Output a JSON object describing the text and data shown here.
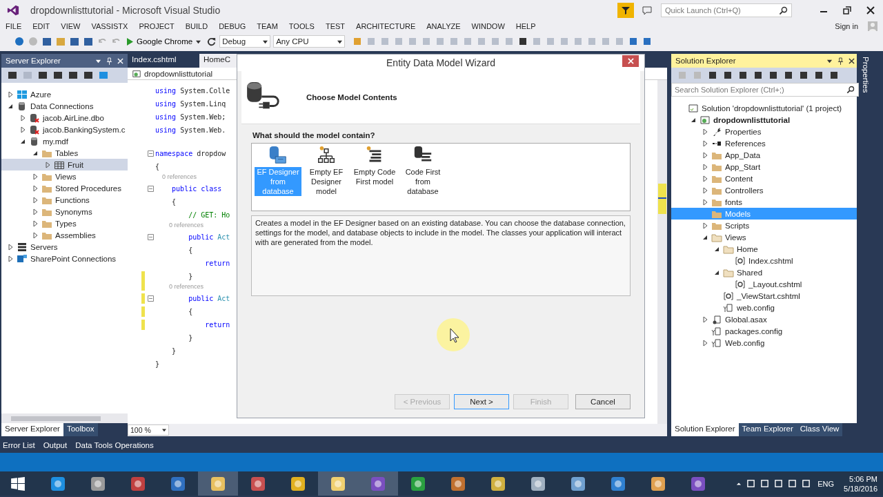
{
  "window": {
    "title": "dropdownlisttutorial - Microsoft Visual Studio",
    "quick_launch": {
      "placeholder": "Quick Launch (Ctrl+Q)"
    }
  },
  "menu": [
    "FILE",
    "EDIT",
    "VIEW",
    "VASSISTX",
    "PROJECT",
    "BUILD",
    "DEBUG",
    "TEAM",
    "TOOLS",
    "TEST",
    "ARCHITECTURE",
    "ANALYZE",
    "WINDOW",
    "HELP"
  ],
  "sign_in": "Sign in",
  "toolbar": {
    "run_target": "Google Chrome",
    "configuration": "Debug",
    "platform": "Any CPU"
  },
  "server_explorer": {
    "title": "Server Explorer",
    "tree": [
      {
        "label": "Azure",
        "kind": "azure",
        "expanded": false,
        "selected": false
      },
      {
        "label": "Data Connections",
        "kind": "connections",
        "expanded": true,
        "selected": false,
        "children": [
          {
            "label": "jacob.AirLine.dbo",
            "kind": "db-error",
            "expanded": false,
            "selected": false
          },
          {
            "label": "jacob.BankingSystem.c",
            "kind": "db-error",
            "expanded": false,
            "selected": false
          },
          {
            "label": "my.mdf",
            "kind": "db",
            "expanded": true,
            "selected": false,
            "children": [
              {
                "label": "Tables",
                "kind": "folder",
                "expanded": true,
                "selected": false,
                "children": [
                  {
                    "label": "Fruit",
                    "kind": "table",
                    "expanded": false,
                    "selected": true
                  }
                ]
              },
              {
                "label": "Views",
                "kind": "folder",
                "expanded": false,
                "selected": false
              },
              {
                "label": "Stored Procedures",
                "kind": "folder",
                "expanded": false,
                "selected": false
              },
              {
                "label": "Functions",
                "kind": "folder",
                "expanded": false,
                "selected": false
              },
              {
                "label": "Synonyms",
                "kind": "folder",
                "expanded": false,
                "selected": false
              },
              {
                "label": "Types",
                "kind": "folder",
                "expanded": false,
                "selected": false
              },
              {
                "label": "Assemblies",
                "kind": "folder",
                "expanded": false,
                "selected": false
              }
            ]
          }
        ]
      },
      {
        "label": "Servers",
        "kind": "servers",
        "expanded": false,
        "selected": false
      },
      {
        "label": "SharePoint Connections",
        "kind": "sharepoint",
        "expanded": false,
        "selected": false
      }
    ]
  },
  "editor": {
    "tabs": [
      {
        "label": "Index.cshtml",
        "selected": false
      },
      {
        "label": "HomeC",
        "selected": true
      }
    ],
    "navigation": "dropdownlisttutorial",
    "zoom": "100 %",
    "lines": [
      {
        "kind": "code",
        "fold": false,
        "changed": false,
        "segments": [
          {
            "kind": "keyword",
            "text": "using"
          },
          {
            "kind": "plain",
            "text": " System.Colle"
          }
        ]
      },
      {
        "kind": "code",
        "fold": false,
        "changed": false,
        "segments": [
          {
            "kind": "keyword",
            "text": "using"
          },
          {
            "kind": "plain",
            "text": " System.Linq"
          }
        ]
      },
      {
        "kind": "code",
        "fold": false,
        "changed": false,
        "segments": [
          {
            "kind": "keyword",
            "text": "using"
          },
          {
            "kind": "plain",
            "text": " System.Web;"
          }
        ]
      },
      {
        "kind": "code",
        "fold": false,
        "changed": false,
        "segments": [
          {
            "kind": "keyword",
            "text": "using"
          },
          {
            "kind": "plain",
            "text": " System.Web."
          }
        ]
      },
      {
        "kind": "blank",
        "fold": false,
        "changed": false
      },
      {
        "kind": "code",
        "fold": true,
        "changed": false,
        "segments": [
          {
            "kind": "keyword",
            "text": "namespace"
          },
          {
            "kind": "plain",
            "text": " dropdow"
          }
        ]
      },
      {
        "kind": "code",
        "fold": false,
        "changed": false,
        "segments": [
          {
            "kind": "plain",
            "text": "{"
          }
        ]
      },
      {
        "kind": "lens",
        "fold": false,
        "changed": false,
        "segments": [
          {
            "kind": "plain",
            "text": "    0 references"
          }
        ]
      },
      {
        "kind": "code",
        "fold": true,
        "changed": false,
        "segments": [
          {
            "kind": "keyword",
            "text": "    public class"
          }
        ]
      },
      {
        "kind": "code",
        "fold": false,
        "changed": false,
        "segments": [
          {
            "kind": "plain",
            "text": "    {"
          }
        ]
      },
      {
        "kind": "code",
        "fold": false,
        "changed": false,
        "segments": [
          {
            "kind": "comment",
            "text": "        // GET: Ho"
          }
        ]
      },
      {
        "kind": "lens",
        "fold": false,
        "changed": false,
        "segments": [
          {
            "kind": "plain",
            "text": "        0 references"
          }
        ]
      },
      {
        "kind": "code",
        "fold": true,
        "changed": false,
        "segments": [
          {
            "kind": "keyword",
            "text": "        public"
          },
          {
            "kind": "type",
            "text": " Act"
          }
        ]
      },
      {
        "kind": "code",
        "fold": false,
        "changed": false,
        "segments": [
          {
            "kind": "plain",
            "text": "        {"
          }
        ]
      },
      {
        "kind": "code",
        "fold": false,
        "changed": false,
        "segments": [
          {
            "kind": "keyword",
            "text": "            return"
          }
        ]
      },
      {
        "kind": "code",
        "fold": false,
        "changed": true,
        "segments": [
          {
            "kind": "plain",
            "text": "        }"
          }
        ]
      },
      {
        "kind": "lens",
        "fold": false,
        "changed": true,
        "segments": [
          {
            "kind": "plain",
            "text": "        0 references"
          }
        ]
      },
      {
        "kind": "code",
        "fold": true,
        "changed": true,
        "segments": [
          {
            "kind": "keyword",
            "text": "        public"
          },
          {
            "kind": "type",
            "text": " Act"
          }
        ]
      },
      {
        "kind": "code",
        "fold": false,
        "changed": true,
        "segments": [
          {
            "kind": "plain",
            "text": "        {"
          }
        ]
      },
      {
        "kind": "code",
        "fold": false,
        "changed": true,
        "segments": [
          {
            "kind": "keyword",
            "text": "            return"
          }
        ]
      },
      {
        "kind": "code",
        "fold": false,
        "changed": false,
        "segments": [
          {
            "kind": "plain",
            "text": "        }"
          }
        ]
      },
      {
        "kind": "code",
        "fold": false,
        "changed": false,
        "segments": [
          {
            "kind": "plain",
            "text": "    }"
          }
        ]
      },
      {
        "kind": "code",
        "fold": false,
        "changed": false,
        "segments": [
          {
            "kind": "plain",
            "text": "}"
          }
        ]
      }
    ]
  },
  "dialog": {
    "title": "Entity Data Model Wizard",
    "heading": "Choose Model Contents",
    "question": "What should the model contain?",
    "options": [
      {
        "label": "EF Designer from database",
        "kind": "ef-database",
        "selected": true
      },
      {
        "label": "Empty EF Designer model",
        "kind": "ef-empty",
        "selected": false
      },
      {
        "label": "Empty Code First model",
        "kind": "code-empty",
        "selected": false
      },
      {
        "label": "Code First from database",
        "kind": "code-database",
        "selected": false
      }
    ],
    "description": "Creates a model in the EF Designer based on an existing database. You can choose the database connection, settings for the model, and database objects to include in the model. The classes your application will interact with are generated from the model.",
    "buttons": [
      {
        "label": "< Previous",
        "disabled": true,
        "focused": false
      },
      {
        "label": "Next >",
        "disabled": false,
        "focused": true
      },
      {
        "label": "Finish",
        "disabled": true,
        "focused": false
      },
      {
        "label": "Cancel",
        "disabled": false,
        "focused": false
      }
    ]
  },
  "solution_explorer": {
    "title": "Solution Explorer",
    "search": {
      "placeholder": "Search Solution Explorer (Ctrl+;)"
    },
    "tree": [
      {
        "label": "Solution 'dropdownlisttutorial' (1 project)",
        "kind": "solution",
        "selected": false,
        "children": [
          {
            "label": "dropdownlisttutorial",
            "kind": "project",
            "expanded": true,
            "selected": false,
            "children": [
              {
                "label": "Properties",
                "kind": "wrench",
                "expanded": false,
                "selected": false
              },
              {
                "label": "References",
                "kind": "refs",
                "expanded": false,
                "selected": false
              },
              {
                "label": "App_Data",
                "kind": "folder",
                "expanded": false,
                "selected": false
              },
              {
                "label": "App_Start",
                "kind": "folder",
                "expanded": false,
                "selected": false
              },
              {
                "label": "Content",
                "kind": "folder",
                "expanded": false,
                "selected": false
              },
              {
                "label": "Controllers",
                "kind": "folder",
                "expanded": false,
                "selected": false
              },
              {
                "label": "fonts",
                "kind": "folder",
                "expanded": false,
                "selected": false
              },
              {
                "label": "Models",
                "kind": "folder",
                "selected": true
              },
              {
                "label": "Scripts",
                "kind": "folder",
                "expanded": false,
                "selected": false
              },
              {
                "label": "Views",
                "kind": "folder-open",
                "expanded": true,
                "selected": false,
                "children": [
                  {
                    "label": "Home",
                    "kind": "folder-open",
                    "expanded": true,
                    "selected": false,
                    "children": [
                      {
                        "label": "Index.cshtml",
                        "kind": "razor",
                        "selected": false
                      }
                    ]
                  },
                  {
                    "label": "Shared",
                    "kind": "folder-open",
                    "expanded": true,
                    "selected": false,
                    "children": [
                      {
                        "label": "_Layout.cshtml",
                        "kind": "razor",
                        "selected": false
                      }
                    ]
                  },
                  {
                    "label": "_ViewStart.cshtml",
                    "kind": "razor",
                    "selected": false
                  },
                  {
                    "label": "web.config",
                    "kind": "config",
                    "selected": false
                  }
                ]
              },
              {
                "label": "Global.asax",
                "kind": "asax",
                "expanded": false,
                "selected": false
              },
              {
                "label": "packages.config",
                "kind": "config",
                "selected": false
              },
              {
                "label": "Web.config",
                "kind": "config",
                "expanded": false,
                "selected": false
              }
            ]
          }
        ]
      }
    ]
  },
  "properties_tab": "Properties",
  "left_panel_tabs": [
    {
      "label": "Server Explorer",
      "selected": true
    },
    {
      "label": "Toolbox",
      "selected": false
    }
  ],
  "right_panel_tabs": [
    {
      "label": "Solution Explorer",
      "selected": true
    },
    {
      "label": "Team Explorer",
      "selected": false
    },
    {
      "label": "Class View",
      "selected": false
    }
  ],
  "bottom_tabs": [
    "Error List",
    "Output",
    "Data Tools Operations"
  ],
  "taskbar": {
    "language": "ENG",
    "time": "5:06 PM",
    "date": "5/18/2016"
  }
}
